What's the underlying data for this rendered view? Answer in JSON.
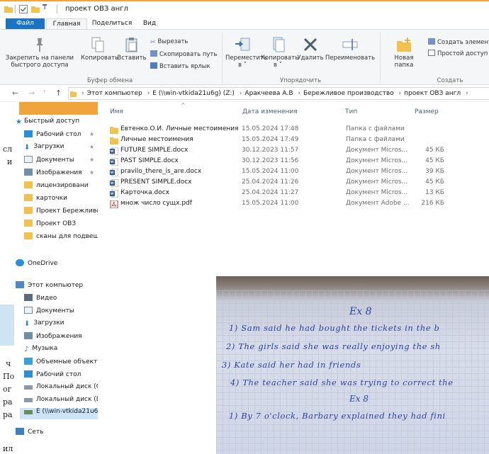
{
  "window": {
    "title": "проект ОВЗ англ"
  },
  "tabs": [
    "Файл",
    "Главная",
    "Поделиться",
    "Вид"
  ],
  "ribbon": {
    "pin_label_1": "Закрепить на панели",
    "pin_label_2": "быстрого доступа",
    "copy": "Копировать",
    "paste": "Вставить",
    "cut": "Вырезать",
    "copy_path": "Скопировать путь",
    "paste_shortcut": "Вставить ярлык",
    "clipboard_group": "Буфер обмена",
    "move_to": "Переместить",
    "move_to_arrow": "в ˅",
    "copy_to": "Копировать",
    "copy_to_arrow": "в ˅",
    "delete": "Удалить",
    "rename": "Переименовать",
    "organize_group": "Упорядочить",
    "new_folder_1": "Новая",
    "new_folder_2": "папка",
    "new_item": "Создать элемент",
    "easy_access": "Простой доступ",
    "create_group": "Создать"
  },
  "breadcrumbs": [
    "Этот компьютер",
    "E (\\\\win-vtkida21u6g) (Z:)",
    "Аракчеева А.В",
    "Бережливое производство",
    "проект ОВЗ англ"
  ],
  "nav": {
    "quick_access": "Быстрый доступ",
    "items": [
      "Рабочий стол",
      "Загрузки",
      "Документы",
      "Изображения",
      "лицензировани",
      "карточки",
      "Проект Бережливс",
      "Проект ОВЗ",
      "сканы для подвеш"
    ],
    "onedrive": "OneDrive",
    "this_pc": "Этот компьютер",
    "pc_items": [
      "Видео",
      "Документы",
      "Загрузки",
      "Изображения",
      "Музыка",
      "Объемные объекті",
      "Рабочий стол",
      "Локальный диск (С",
      "Локальный диск (D",
      "E (\\\\win-vtkida21u6"
    ],
    "network": "Сеть"
  },
  "columns": {
    "name": "Имя",
    "date": "Дата изменения",
    "type": "Тип",
    "size": "Размер"
  },
  "files": [
    {
      "name": "Евтенко.О.И. Личные местоимения",
      "date": "15.05.2024 17:48",
      "type": "Папка с файлами",
      "size": "",
      "kind": "folder"
    },
    {
      "name": "Личные местоимения",
      "date": "15.05.2024 17:49",
      "type": "Папка с файлами",
      "size": "",
      "kind": "folder"
    },
    {
      "name": "FUTURE SIMPLE.docx",
      "date": "30.12.2023 11:57",
      "type": "Документ Micros...",
      "size": "45 КБ",
      "kind": "docx"
    },
    {
      "name": "PAST SIMPLE.docx",
      "date": "30.12.2023 11:56",
      "type": "Документ Micros...",
      "size": "45 КБ",
      "kind": "docx"
    },
    {
      "name": "pravilo_there_is_are.docx",
      "date": "15.05.2024 11:00",
      "type": "Документ Micros...",
      "size": "39 КБ",
      "kind": "docx"
    },
    {
      "name": "PRESENT SIMPLE.docx",
      "date": "25.04.2024 11:26",
      "type": "Документ Micros...",
      "size": "45 КБ",
      "kind": "docx"
    },
    {
      "name": "Карточка.docx",
      "date": "25.04.2024 11:27",
      "type": "Документ Micros...",
      "size": "13 КБ",
      "kind": "docx"
    },
    {
      "name": "множ число сущх.pdf",
      "date": "15.05.2024 11:00",
      "type": "Документ Adobe ...",
      "size": "216 КБ",
      "kind": "pdf"
    }
  ],
  "background_fragments": [
    "сл",
    "и",
    "ч",
    "По",
    "ог",
    "ра",
    "ра",
    "ил"
  ],
  "notebook": {
    "heading": "Ex 8",
    "lines": [
      "1) Sam said he had bought the tickets in the b",
      "2) The girls said she was really enjoying the sh",
      "3) Kate said her had in friends",
      "4) The teacher said she was trying to correct the",
      "Ex 8",
      "1) By 7 o'clock, Barbary explained they had fini"
    ]
  }
}
